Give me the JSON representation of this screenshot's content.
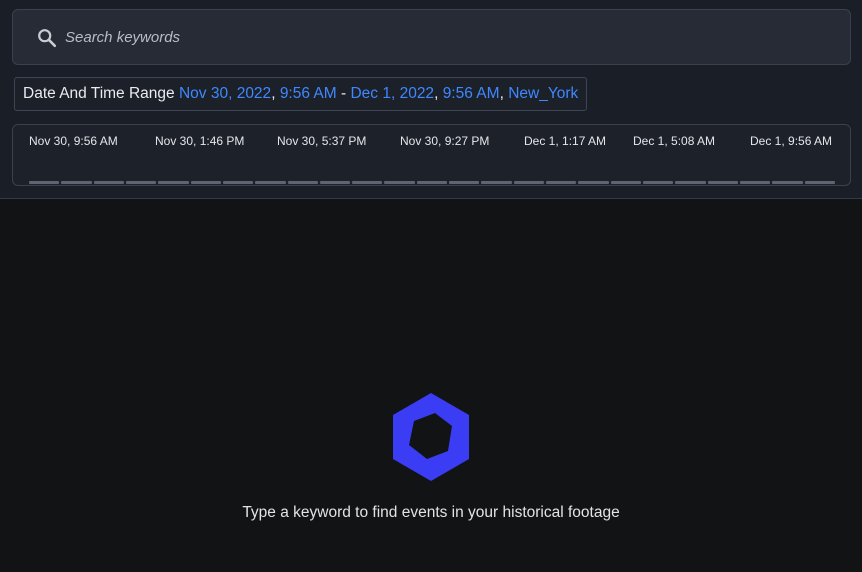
{
  "search": {
    "placeholder": "Search keywords",
    "icon": "search-icon"
  },
  "range": {
    "label": "Date And Time Range",
    "start_date": "Nov 30, 2022",
    "start_time": "9:56 AM",
    "separator": " - ",
    "end_date": "Dec 1, 2022",
    "end_time": "9:56 AM",
    "timezone": "New_York",
    "comma": ", "
  },
  "timeline": {
    "ticks": [
      "Nov 30, 9:56 AM",
      "Nov 30, 1:46 PM",
      "Nov 30, 5:37 PM",
      "Nov 30, 9:27 PM",
      "Dec 1, 1:17 AM",
      "Dec 1, 5:08 AM",
      "Dec 1, 9:56 AM"
    ]
  },
  "empty_state": {
    "icon": "hexagon-logo-icon",
    "message": "Type a keyword to find events in your historical footage"
  },
  "colors": {
    "accent": "#3f88ff",
    "logo": "#3b3df5"
  }
}
